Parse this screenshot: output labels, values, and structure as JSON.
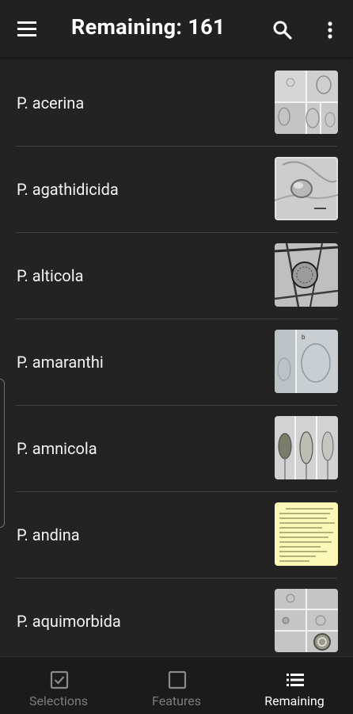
{
  "appbar": {
    "title": "Remaining: 161",
    "menu_icon": "menu-icon",
    "search_icon": "search-icon",
    "more_icon": "more-vert-icon"
  },
  "species": [
    {
      "name": "P. acerina",
      "thumb": "microscopy-grid"
    },
    {
      "name": "P. agathidicida",
      "thumb": "microscopy-sporangium"
    },
    {
      "name": "P. alticola",
      "thumb": "microscopy-hyphae-dark"
    },
    {
      "name": "P. amaranthi",
      "thumb": "microscopy-light"
    },
    {
      "name": "P. amnicola",
      "thumb": "microscopy-panels"
    },
    {
      "name": "P. andina",
      "thumb": "text-yellow-table"
    },
    {
      "name": "P. aquimorbida",
      "thumb": "microscopy-grid-gray"
    }
  ],
  "bottomnav": {
    "items": [
      {
        "label": "Selections",
        "icon": "checkbox-checked-icon",
        "active": false
      },
      {
        "label": "Features",
        "icon": "checkbox-empty-icon",
        "active": false
      },
      {
        "label": "Remaining",
        "icon": "list-icon",
        "active": true
      }
    ]
  },
  "colors": {
    "background": "#232323",
    "appbar": "#212121",
    "bottomnav": "#1b1b1b",
    "text": "#f3f3f3",
    "inactive": "#7d7d7d"
  }
}
